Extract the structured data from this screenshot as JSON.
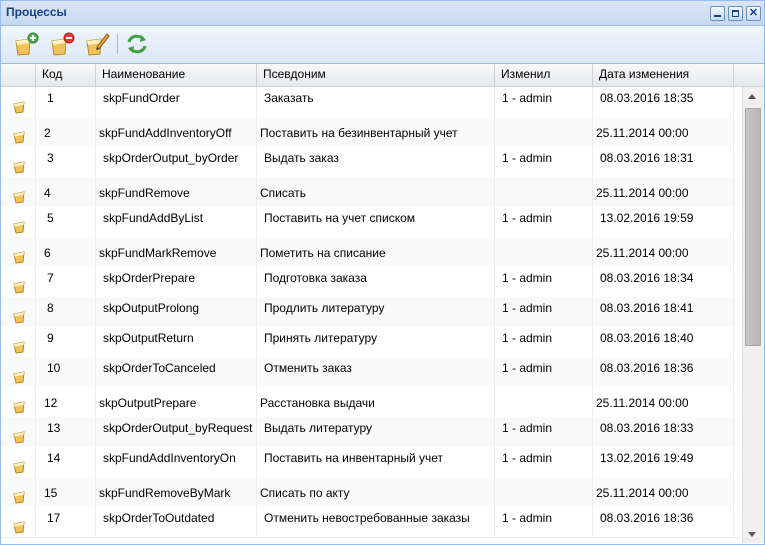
{
  "window": {
    "title": "Процессы"
  },
  "toolbar": {
    "buttons": [
      {
        "icon": "add-process-icon"
      },
      {
        "icon": "delete-process-icon"
      },
      {
        "icon": "edit-process-icon"
      },
      {
        "icon": "refresh-icon"
      }
    ]
  },
  "grid": {
    "columns": [
      "Код",
      "Наименование",
      "Псевдоним",
      "Изменил",
      "Дата изменения"
    ],
    "rows": [
      {
        "code": "1",
        "name": "skpFundOrder",
        "alias": "Заказать",
        "modified_by": "1 - admin",
        "date": "08.03.2016 18:35",
        "shifted": false
      },
      {
        "code": "2",
        "name": "skpFundAddInventoryOff",
        "alias": "Поставить на безинвентарный учет",
        "modified_by": "",
        "date": "25.11.2014 00:00",
        "shifted": true
      },
      {
        "code": "3",
        "name": "skpOrderOutput_byOrder",
        "alias": "Выдать заказ",
        "modified_by": "1 - admin",
        "date": "08.03.2016 18:31",
        "shifted": false
      },
      {
        "code": "4",
        "name": "skpFundRemove",
        "alias": "Списать",
        "modified_by": "",
        "date": "25.11.2014 00:00",
        "shifted": true
      },
      {
        "code": "5",
        "name": "skpFundAddByList",
        "alias": "Поставить на учет списком",
        "modified_by": "1 - admin",
        "date": "13.02.2016 19:59",
        "shifted": false
      },
      {
        "code": "6",
        "name": "skpFundMarkRemove",
        "alias": "Пометить на списание",
        "modified_by": "",
        "date": "25.11.2014 00:00",
        "shifted": true
      },
      {
        "code": "7",
        "name": "skpOrderPrepare",
        "alias": "Подготовка заказа",
        "modified_by": "1 - admin",
        "date": "08.03.2016 18:34",
        "shifted": false
      },
      {
        "code": "8",
        "name": "skpOutputProlong",
        "alias": "Продлить литературу",
        "modified_by": "1 - admin",
        "date": "08.03.2016 18:41",
        "shifted": false
      },
      {
        "code": "9",
        "name": "skpOutputReturn",
        "alias": "Принять литературу",
        "modified_by": "1 - admin",
        "date": "08.03.2016 18:40",
        "shifted": false
      },
      {
        "code": "10",
        "name": "skpOrderToCanceled",
        "alias": "Отменить заказ",
        "modified_by": "1 - admin",
        "date": "08.03.2016 18:36",
        "shifted": false
      },
      {
        "code": "12",
        "name": "skpOutputPrepare",
        "alias": "Расстановка выдачи",
        "modified_by": "",
        "date": "25.11.2014 00:00",
        "shifted": true
      },
      {
        "code": "13",
        "name": "skpOrderOutput_byRequest",
        "alias": "Выдать литературу",
        "modified_by": "1 - admin",
        "date": "08.03.2016 18:33",
        "shifted": false
      },
      {
        "code": "14",
        "name": "skpFundAddInventoryOn",
        "alias": "Поставить на инвентарный учет",
        "modified_by": "1 - admin",
        "date": "13.02.2016 19:49",
        "shifted": false
      },
      {
        "code": "15",
        "name": "skpFundRemoveByMark",
        "alias": "Списать по акту",
        "modified_by": "",
        "date": "25.11.2014 00:00",
        "shifted": true
      },
      {
        "code": "17",
        "name": "skpOrderToOutdated",
        "alias": "Отменить невостребованные заказы",
        "modified_by": "1 - admin",
        "date": "08.03.2016 18:36",
        "shifted": false
      }
    ]
  },
  "colors": {
    "title_text": "#15428b",
    "header_border": "#99bbe8"
  }
}
